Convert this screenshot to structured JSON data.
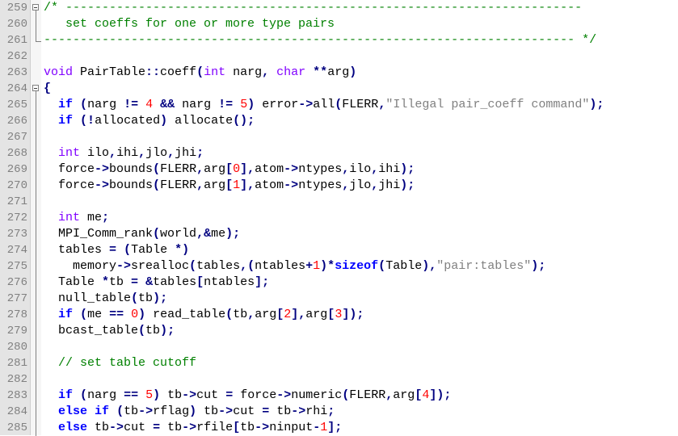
{
  "colors": {
    "keyword": "#0000ff",
    "type": "#8000ff",
    "comment": "#008000",
    "string": "#808080",
    "number": "#ff0000",
    "operator": "#000080",
    "text": "#000000",
    "gutter_bg": "#e4e4e4",
    "line_number": "#808080"
  },
  "lines": [
    {
      "num": "259",
      "fold": "box",
      "tokens": [
        {
          "t": "cm",
          "v": "/* -----------------------------------------------------------------------"
        }
      ]
    },
    {
      "num": "260",
      "fold": "line",
      "tokens": [
        {
          "t": "cm",
          "v": "   set coeffs for one or more type pairs"
        }
      ]
    },
    {
      "num": "261",
      "fold": "end",
      "tokens": [
        {
          "t": "cm",
          "v": "------------------------------------------------------------------------- */"
        }
      ]
    },
    {
      "num": "262",
      "fold": "none",
      "tokens": []
    },
    {
      "num": "263",
      "fold": "none",
      "tokens": [
        {
          "t": "ty",
          "v": "void"
        },
        {
          "t": "tx",
          "v": " PairTable"
        },
        {
          "t": "op",
          "v": "::"
        },
        {
          "t": "tx",
          "v": "coeff"
        },
        {
          "t": "op",
          "v": "("
        },
        {
          "t": "ty",
          "v": "int"
        },
        {
          "t": "tx",
          "v": " narg"
        },
        {
          "t": "op",
          "v": ","
        },
        {
          "t": "tx",
          "v": " "
        },
        {
          "t": "ty",
          "v": "char"
        },
        {
          "t": "tx",
          "v": " "
        },
        {
          "t": "op",
          "v": "**"
        },
        {
          "t": "tx",
          "v": "arg"
        },
        {
          "t": "op",
          "v": ")"
        }
      ]
    },
    {
      "num": "264",
      "fold": "box",
      "tokens": [
        {
          "t": "op",
          "v": "{"
        }
      ]
    },
    {
      "num": "265",
      "fold": "line",
      "tokens": [
        {
          "t": "tx",
          "v": "  "
        },
        {
          "t": "kw",
          "v": "if"
        },
        {
          "t": "tx",
          "v": " "
        },
        {
          "t": "op",
          "v": "("
        },
        {
          "t": "tx",
          "v": "narg "
        },
        {
          "t": "op",
          "v": "!="
        },
        {
          "t": "tx",
          "v": " "
        },
        {
          "t": "nu",
          "v": "4"
        },
        {
          "t": "tx",
          "v": " "
        },
        {
          "t": "op",
          "v": "&&"
        },
        {
          "t": "tx",
          "v": " narg "
        },
        {
          "t": "op",
          "v": "!="
        },
        {
          "t": "tx",
          "v": " "
        },
        {
          "t": "nu",
          "v": "5"
        },
        {
          "t": "op",
          "v": ")"
        },
        {
          "t": "tx",
          "v": " error"
        },
        {
          "t": "op",
          "v": "->"
        },
        {
          "t": "tx",
          "v": "all"
        },
        {
          "t": "op",
          "v": "("
        },
        {
          "t": "tx",
          "v": "FLERR"
        },
        {
          "t": "op",
          "v": ","
        },
        {
          "t": "st",
          "v": "\"Illegal pair_coeff command\""
        },
        {
          "t": "op",
          "v": ");"
        }
      ]
    },
    {
      "num": "266",
      "fold": "line",
      "tokens": [
        {
          "t": "tx",
          "v": "  "
        },
        {
          "t": "kw",
          "v": "if"
        },
        {
          "t": "tx",
          "v": " "
        },
        {
          "t": "op",
          "v": "(!"
        },
        {
          "t": "tx",
          "v": "allocated"
        },
        {
          "t": "op",
          "v": ")"
        },
        {
          "t": "tx",
          "v": " allocate"
        },
        {
          "t": "op",
          "v": "();"
        }
      ]
    },
    {
      "num": "267",
      "fold": "line",
      "tokens": []
    },
    {
      "num": "268",
      "fold": "line",
      "tokens": [
        {
          "t": "tx",
          "v": "  "
        },
        {
          "t": "ty",
          "v": "int"
        },
        {
          "t": "tx",
          "v": " ilo"
        },
        {
          "t": "op",
          "v": ","
        },
        {
          "t": "tx",
          "v": "ihi"
        },
        {
          "t": "op",
          "v": ","
        },
        {
          "t": "tx",
          "v": "jlo"
        },
        {
          "t": "op",
          "v": ","
        },
        {
          "t": "tx",
          "v": "jhi"
        },
        {
          "t": "op",
          "v": ";"
        }
      ]
    },
    {
      "num": "269",
      "fold": "line",
      "tokens": [
        {
          "t": "tx",
          "v": "  force"
        },
        {
          "t": "op",
          "v": "->"
        },
        {
          "t": "tx",
          "v": "bounds"
        },
        {
          "t": "op",
          "v": "("
        },
        {
          "t": "tx",
          "v": "FLERR"
        },
        {
          "t": "op",
          "v": ","
        },
        {
          "t": "tx",
          "v": "arg"
        },
        {
          "t": "op",
          "v": "["
        },
        {
          "t": "nu",
          "v": "0"
        },
        {
          "t": "op",
          "v": "],"
        },
        {
          "t": "tx",
          "v": "atom"
        },
        {
          "t": "op",
          "v": "->"
        },
        {
          "t": "tx",
          "v": "ntypes"
        },
        {
          "t": "op",
          "v": ","
        },
        {
          "t": "tx",
          "v": "ilo"
        },
        {
          "t": "op",
          "v": ","
        },
        {
          "t": "tx",
          "v": "ihi"
        },
        {
          "t": "op",
          "v": ");"
        }
      ]
    },
    {
      "num": "270",
      "fold": "line",
      "tokens": [
        {
          "t": "tx",
          "v": "  force"
        },
        {
          "t": "op",
          "v": "->"
        },
        {
          "t": "tx",
          "v": "bounds"
        },
        {
          "t": "op",
          "v": "("
        },
        {
          "t": "tx",
          "v": "FLERR"
        },
        {
          "t": "op",
          "v": ","
        },
        {
          "t": "tx",
          "v": "arg"
        },
        {
          "t": "op",
          "v": "["
        },
        {
          "t": "nu",
          "v": "1"
        },
        {
          "t": "op",
          "v": "],"
        },
        {
          "t": "tx",
          "v": "atom"
        },
        {
          "t": "op",
          "v": "->"
        },
        {
          "t": "tx",
          "v": "ntypes"
        },
        {
          "t": "op",
          "v": ","
        },
        {
          "t": "tx",
          "v": "jlo"
        },
        {
          "t": "op",
          "v": ","
        },
        {
          "t": "tx",
          "v": "jhi"
        },
        {
          "t": "op",
          "v": ");"
        }
      ]
    },
    {
      "num": "271",
      "fold": "line",
      "tokens": []
    },
    {
      "num": "272",
      "fold": "line",
      "tokens": [
        {
          "t": "tx",
          "v": "  "
        },
        {
          "t": "ty",
          "v": "int"
        },
        {
          "t": "tx",
          "v": " me"
        },
        {
          "t": "op",
          "v": ";"
        }
      ]
    },
    {
      "num": "273",
      "fold": "line",
      "tokens": [
        {
          "t": "tx",
          "v": "  MPI_Comm_rank"
        },
        {
          "t": "op",
          "v": "("
        },
        {
          "t": "tx",
          "v": "world"
        },
        {
          "t": "op",
          "v": ",&"
        },
        {
          "t": "tx",
          "v": "me"
        },
        {
          "t": "op",
          "v": ");"
        }
      ]
    },
    {
      "num": "274",
      "fold": "line",
      "tokens": [
        {
          "t": "tx",
          "v": "  tables "
        },
        {
          "t": "op",
          "v": "="
        },
        {
          "t": "tx",
          "v": " "
        },
        {
          "t": "op",
          "v": "("
        },
        {
          "t": "tx",
          "v": "Table "
        },
        {
          "t": "op",
          "v": "*)"
        }
      ]
    },
    {
      "num": "275",
      "fold": "line",
      "tokens": [
        {
          "t": "tx",
          "v": "    memory"
        },
        {
          "t": "op",
          "v": "->"
        },
        {
          "t": "tx",
          "v": "srealloc"
        },
        {
          "t": "op",
          "v": "("
        },
        {
          "t": "tx",
          "v": "tables"
        },
        {
          "t": "op",
          "v": ",("
        },
        {
          "t": "tx",
          "v": "ntables"
        },
        {
          "t": "op",
          "v": "+"
        },
        {
          "t": "nu",
          "v": "1"
        },
        {
          "t": "op",
          "v": ")*"
        },
        {
          "t": "kw",
          "v": "sizeof"
        },
        {
          "t": "op",
          "v": "("
        },
        {
          "t": "tx",
          "v": "Table"
        },
        {
          "t": "op",
          "v": "),"
        },
        {
          "t": "st",
          "v": "\"pair:tables\""
        },
        {
          "t": "op",
          "v": ");"
        }
      ]
    },
    {
      "num": "276",
      "fold": "line",
      "tokens": [
        {
          "t": "tx",
          "v": "  Table "
        },
        {
          "t": "op",
          "v": "*"
        },
        {
          "t": "tx",
          "v": "tb "
        },
        {
          "t": "op",
          "v": "="
        },
        {
          "t": "tx",
          "v": " "
        },
        {
          "t": "op",
          "v": "&"
        },
        {
          "t": "tx",
          "v": "tables"
        },
        {
          "t": "op",
          "v": "["
        },
        {
          "t": "tx",
          "v": "ntables"
        },
        {
          "t": "op",
          "v": "];"
        }
      ]
    },
    {
      "num": "277",
      "fold": "line",
      "tokens": [
        {
          "t": "tx",
          "v": "  null_table"
        },
        {
          "t": "op",
          "v": "("
        },
        {
          "t": "tx",
          "v": "tb"
        },
        {
          "t": "op",
          "v": ");"
        }
      ]
    },
    {
      "num": "278",
      "fold": "line",
      "tokens": [
        {
          "t": "tx",
          "v": "  "
        },
        {
          "t": "kw",
          "v": "if"
        },
        {
          "t": "tx",
          "v": " "
        },
        {
          "t": "op",
          "v": "("
        },
        {
          "t": "tx",
          "v": "me "
        },
        {
          "t": "op",
          "v": "=="
        },
        {
          "t": "tx",
          "v": " "
        },
        {
          "t": "nu",
          "v": "0"
        },
        {
          "t": "op",
          "v": ")"
        },
        {
          "t": "tx",
          "v": " read_table"
        },
        {
          "t": "op",
          "v": "("
        },
        {
          "t": "tx",
          "v": "tb"
        },
        {
          "t": "op",
          "v": ","
        },
        {
          "t": "tx",
          "v": "arg"
        },
        {
          "t": "op",
          "v": "["
        },
        {
          "t": "nu",
          "v": "2"
        },
        {
          "t": "op",
          "v": "],"
        },
        {
          "t": "tx",
          "v": "arg"
        },
        {
          "t": "op",
          "v": "["
        },
        {
          "t": "nu",
          "v": "3"
        },
        {
          "t": "op",
          "v": "]);"
        }
      ]
    },
    {
      "num": "279",
      "fold": "line",
      "tokens": [
        {
          "t": "tx",
          "v": "  bcast_table"
        },
        {
          "t": "op",
          "v": "("
        },
        {
          "t": "tx",
          "v": "tb"
        },
        {
          "t": "op",
          "v": ");"
        }
      ]
    },
    {
      "num": "280",
      "fold": "line",
      "tokens": []
    },
    {
      "num": "281",
      "fold": "line",
      "tokens": [
        {
          "t": "tx",
          "v": "  "
        },
        {
          "t": "cm",
          "v": "// set table cutoff"
        }
      ]
    },
    {
      "num": "282",
      "fold": "line",
      "tokens": []
    },
    {
      "num": "283",
      "fold": "line",
      "tokens": [
        {
          "t": "tx",
          "v": "  "
        },
        {
          "t": "kw",
          "v": "if"
        },
        {
          "t": "tx",
          "v": " "
        },
        {
          "t": "op",
          "v": "("
        },
        {
          "t": "tx",
          "v": "narg "
        },
        {
          "t": "op",
          "v": "=="
        },
        {
          "t": "tx",
          "v": " "
        },
        {
          "t": "nu",
          "v": "5"
        },
        {
          "t": "op",
          "v": ")"
        },
        {
          "t": "tx",
          "v": " tb"
        },
        {
          "t": "op",
          "v": "->"
        },
        {
          "t": "tx",
          "v": "cut "
        },
        {
          "t": "op",
          "v": "="
        },
        {
          "t": "tx",
          "v": " force"
        },
        {
          "t": "op",
          "v": "->"
        },
        {
          "t": "tx",
          "v": "numeric"
        },
        {
          "t": "op",
          "v": "("
        },
        {
          "t": "tx",
          "v": "FLERR"
        },
        {
          "t": "op",
          "v": ","
        },
        {
          "t": "tx",
          "v": "arg"
        },
        {
          "t": "op",
          "v": "["
        },
        {
          "t": "nu",
          "v": "4"
        },
        {
          "t": "op",
          "v": "]);"
        }
      ]
    },
    {
      "num": "284",
      "fold": "line",
      "tokens": [
        {
          "t": "tx",
          "v": "  "
        },
        {
          "t": "kw",
          "v": "else"
        },
        {
          "t": "tx",
          "v": " "
        },
        {
          "t": "kw",
          "v": "if"
        },
        {
          "t": "tx",
          "v": " "
        },
        {
          "t": "op",
          "v": "("
        },
        {
          "t": "tx",
          "v": "tb"
        },
        {
          "t": "op",
          "v": "->"
        },
        {
          "t": "tx",
          "v": "rflag"
        },
        {
          "t": "op",
          "v": ")"
        },
        {
          "t": "tx",
          "v": " tb"
        },
        {
          "t": "op",
          "v": "->"
        },
        {
          "t": "tx",
          "v": "cut "
        },
        {
          "t": "op",
          "v": "="
        },
        {
          "t": "tx",
          "v": " tb"
        },
        {
          "t": "op",
          "v": "->"
        },
        {
          "t": "tx",
          "v": "rhi"
        },
        {
          "t": "op",
          "v": ";"
        }
      ]
    },
    {
      "num": "285",
      "fold": "line",
      "tokens": [
        {
          "t": "tx",
          "v": "  "
        },
        {
          "t": "kw",
          "v": "else"
        },
        {
          "t": "tx",
          "v": " tb"
        },
        {
          "t": "op",
          "v": "->"
        },
        {
          "t": "tx",
          "v": "cut "
        },
        {
          "t": "op",
          "v": "="
        },
        {
          "t": "tx",
          "v": " tb"
        },
        {
          "t": "op",
          "v": "->"
        },
        {
          "t": "tx",
          "v": "rfile"
        },
        {
          "t": "op",
          "v": "["
        },
        {
          "t": "tx",
          "v": "tb"
        },
        {
          "t": "op",
          "v": "->"
        },
        {
          "t": "tx",
          "v": "ninput"
        },
        {
          "t": "op",
          "v": "-"
        },
        {
          "t": "nu",
          "v": "1"
        },
        {
          "t": "op",
          "v": "];"
        }
      ]
    }
  ]
}
